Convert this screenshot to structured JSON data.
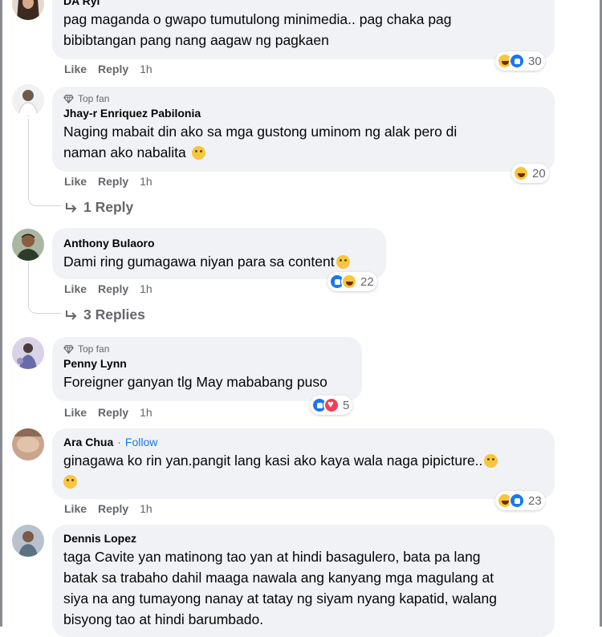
{
  "comments": [
    {
      "name": "DA Ryl",
      "top_fan": "",
      "text_lines": [
        "pag maganda o gwapo tumutulong minimedia.. pag chaka pag",
        "bibibtangan pang nang aagaw ng pagkaen"
      ],
      "like": "Like",
      "reply": "Reply",
      "time": "1h",
      "reaction_icons": [
        "haha",
        "like"
      ],
      "reaction_count": "30"
    },
    {
      "name": "Jhay-r Enriquez Pabilonia",
      "top_fan": "Top fan",
      "text_lines": [
        "Naging mabait din ako sa mga gustong uminom ng alak pero di",
        "naman ako nabalita"
      ],
      "like": "Like",
      "reply": "Reply",
      "time": "1h",
      "reaction_icons": [
        "haha"
      ],
      "reaction_count": "20",
      "replies_label": "1 Reply"
    },
    {
      "name": "Anthony Bulaoro",
      "top_fan": "",
      "text_lines": [
        "Dami ring gumagawa niyan para sa content"
      ],
      "like": "Like",
      "reply": "Reply",
      "time": "1h",
      "reaction_icons": [
        "like",
        "haha"
      ],
      "reaction_count": "22",
      "replies_label": "3 Replies"
    },
    {
      "name": "Penny Lynn",
      "top_fan": "Top fan",
      "text_lines": [
        "Foreigner ganyan tlg May mababang puso"
      ],
      "like": "Like",
      "reply": "Reply",
      "time": "1h",
      "reaction_icons": [
        "like",
        "love"
      ],
      "reaction_count": "5"
    },
    {
      "name": "Ara Chua",
      "follow_sep": "·",
      "follow": "Follow",
      "top_fan": "",
      "text_lines": [
        "ginagawa ko rin yan.pangit lang kasi ako kaya wala naga pipicture..",
        ""
      ],
      "like": "Like",
      "reply": "Reply",
      "time": "1h",
      "reaction_icons": [
        "haha",
        "like"
      ],
      "reaction_count": "23"
    },
    {
      "name": "Dennis Lopez",
      "top_fan": "",
      "text_lines": [
        "taga Cavite yan matinong tao yan at hindi basagulero, bata pa lang",
        "batak sa trabaho dahil maaga nawala ang kanyang mga magulang at",
        "siya na ang tumayong nanay at tatay ng siyam nyang kapatid, walang",
        "bisyong tao at hindi barumbado."
      ]
    }
  ],
  "colors": {
    "bubble": "#f0f2f5",
    "secondary_text": "#65676b",
    "link_blue": "#1877f2",
    "haha": "#f7c63d",
    "like": "#1877f2",
    "love": "#f33e58"
  }
}
